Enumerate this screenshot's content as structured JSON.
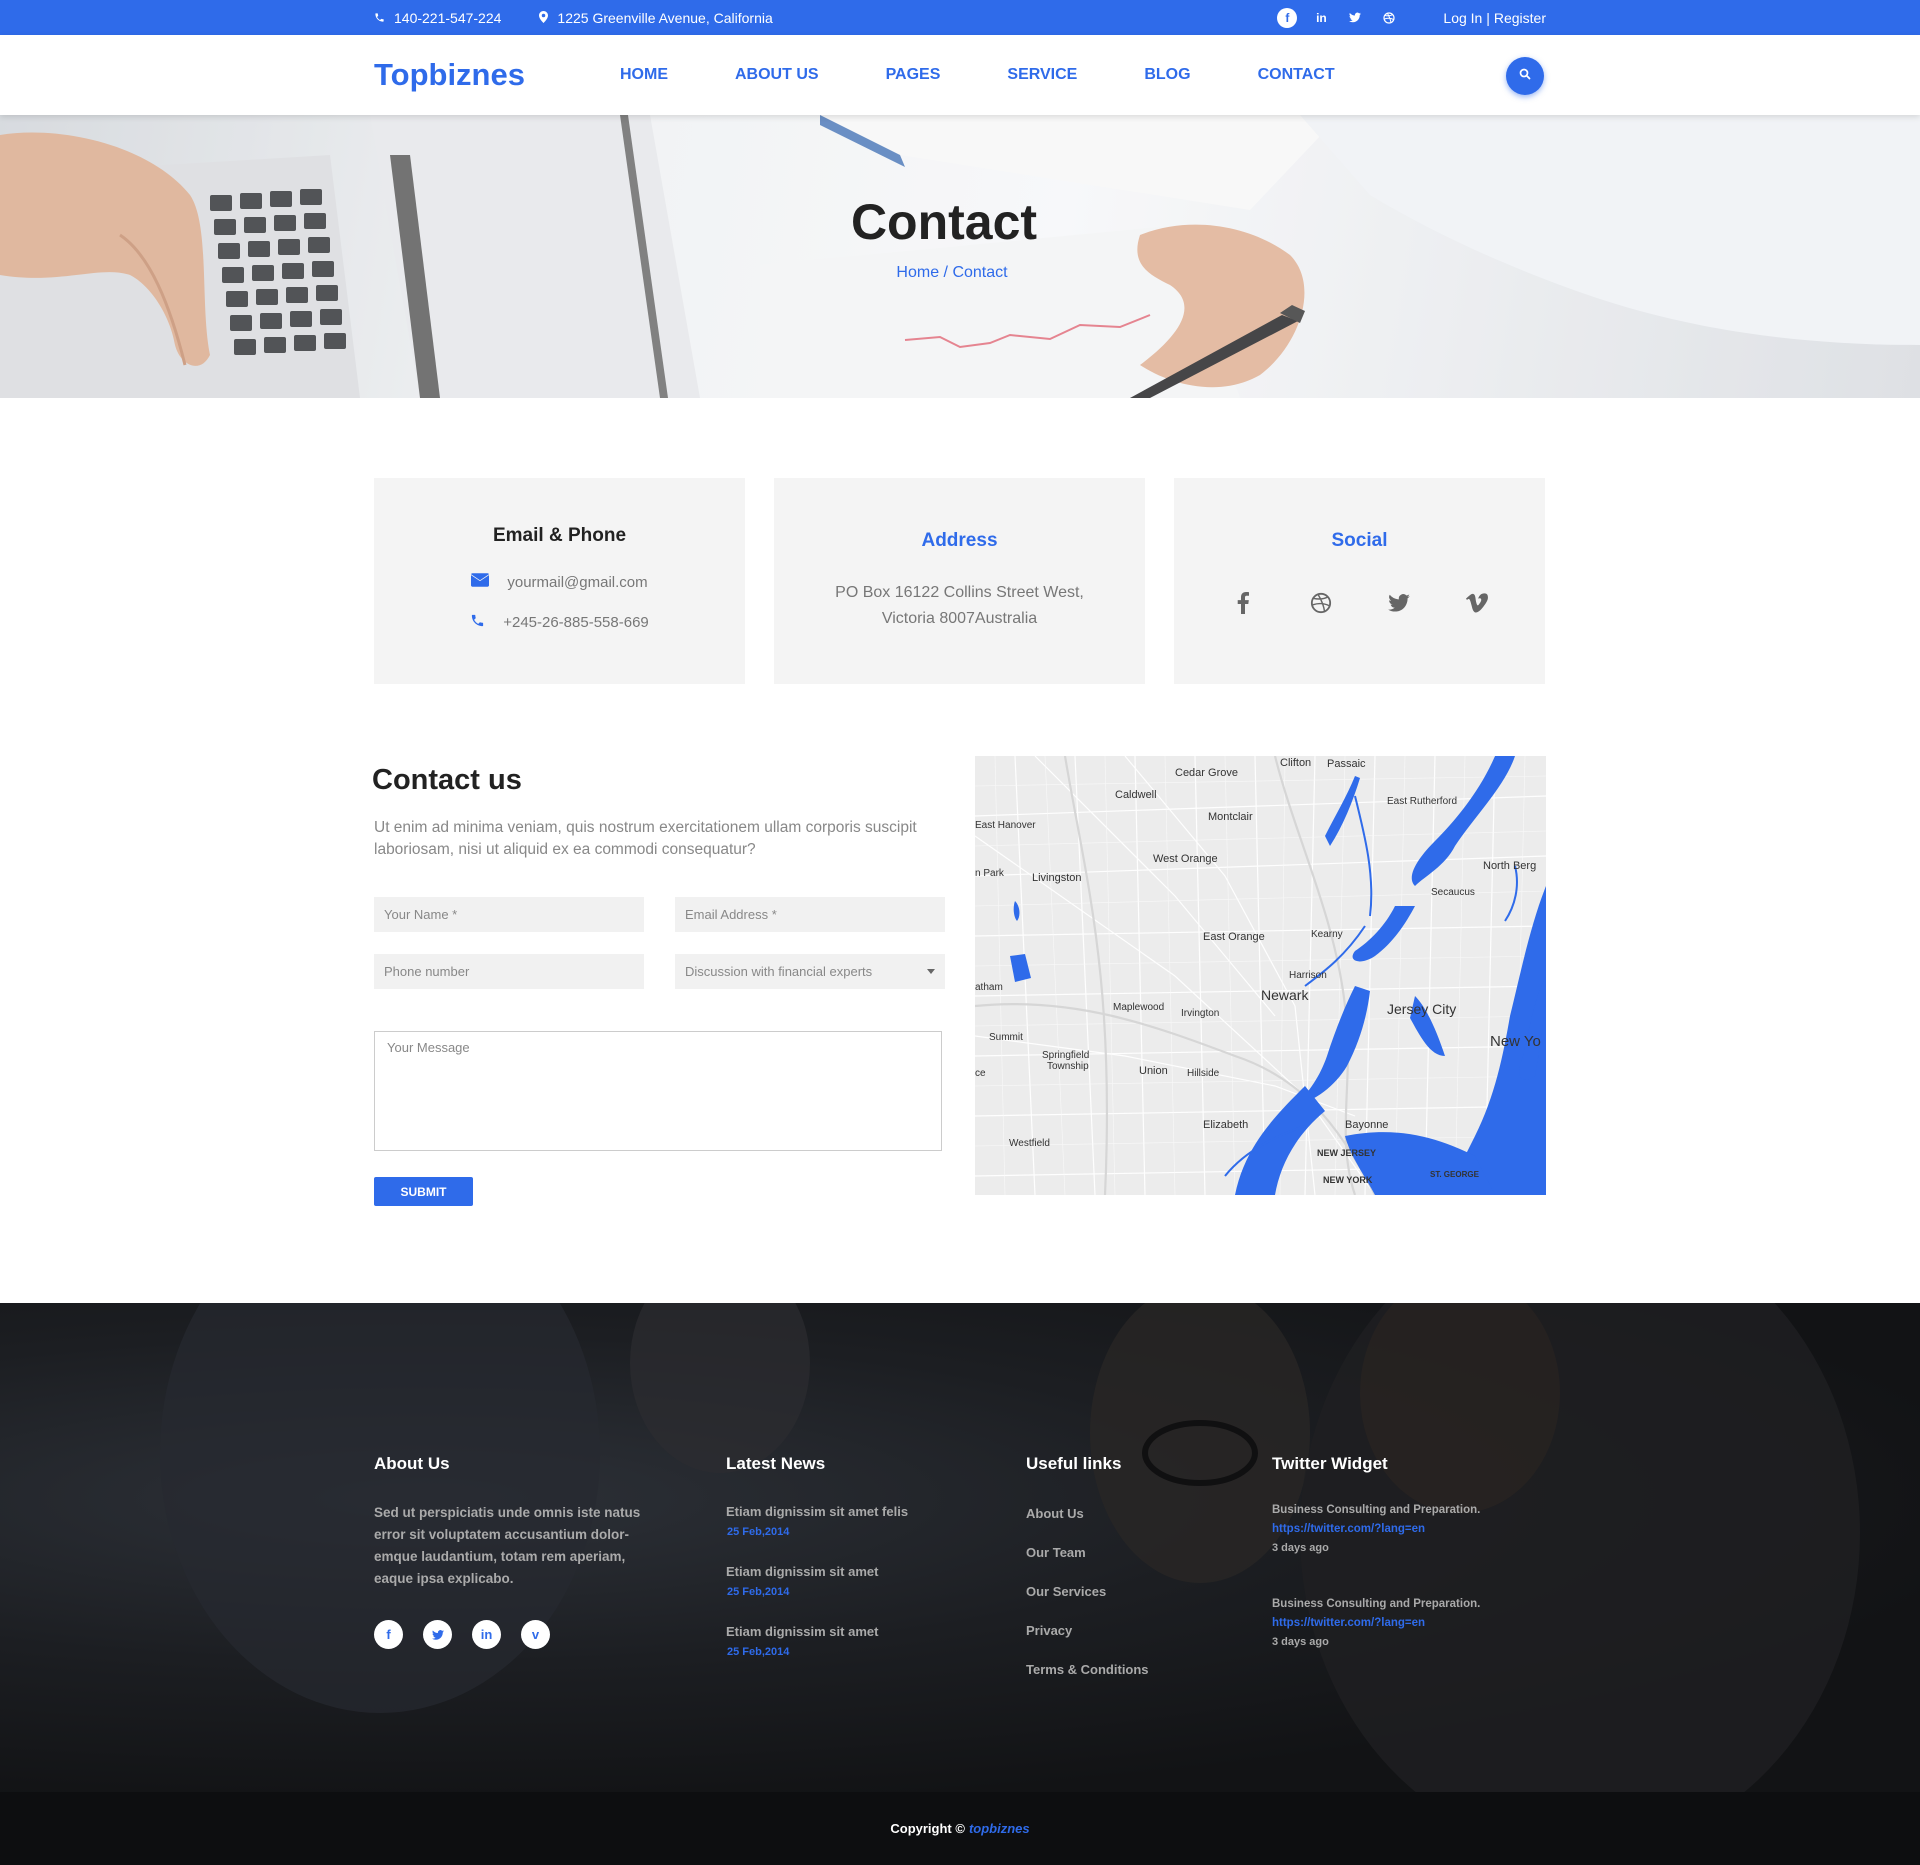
{
  "topbar": {
    "phone": "140-221-547-224",
    "address": "1225 Greenville Avenue, California",
    "social": [
      "f",
      "in",
      "t",
      "d"
    ],
    "login": "Log In |",
    "register": "Register"
  },
  "header": {
    "logo": "Topbiznes",
    "nav": [
      "HOME",
      "ABOUT US",
      "PAGES",
      "SERVICE",
      "BLOG",
      "CONTACT"
    ]
  },
  "hero": {
    "title": "Contact",
    "breadcrumb": "Home / Contact"
  },
  "cards": {
    "email_phone": {
      "title": "Email & Phone",
      "email": "yourmail@gmail.com",
      "phone": "+245-26-885-558-669"
    },
    "address": {
      "title": "Address",
      "line1": "PO Box 16122 Collins Street West,",
      "line2": "Victoria 8007Australia"
    },
    "social": {
      "title": "Social"
    }
  },
  "contact": {
    "title": "Contact us",
    "intro": "Ut enim ad minima veniam, quis nostrum exercitationem ullam corporis suscipit laboriosam, nisi ut aliquid ex ea commodi consequatur?",
    "name_placeholder": "Your Name *",
    "email_placeholder": "Email Address *",
    "phone_placeholder": "Phone number",
    "topic_selected": "Discussion with financial experts",
    "message_placeholder": "Your Message",
    "submit": "SUBMIT"
  },
  "map": {
    "labels": {
      "clifton": "Clifton",
      "passaic": "Passaic",
      "cedar_grove": "Cedar Grove",
      "caldwell": "Caldwell",
      "east_rutherford": "East Rutherford",
      "east_hanover": "East Hanover",
      "montclair": "Montclair",
      "north_bergen": "North Berg",
      "west_orange": "West Orange",
      "secaucus": "Secaucus",
      "park": "n Park",
      "livingston": "Livingston",
      "east_orange": "East Orange",
      "kearny": "Kearny",
      "harrison": "Harrison",
      "chatham": "atham",
      "newark": "Newark",
      "maplewood": "Maplewood",
      "irvington": "Irvington",
      "jersey_city": "Jersey City",
      "summit": "Summit",
      "new_york": "New Yo",
      "springfield": "Springfield",
      "township": "Township",
      "union": "Union",
      "hillside": "Hillside",
      "bayonne": "Bayonne",
      "elizabeth": "Elizabeth",
      "westfield": "Westfield",
      "new_jersey": "NEW JERSEY",
      "new_york_state": "NEW YORK",
      "st_george": "ST. GEORGE",
      "ce": "ce"
    },
    "water_color": "#2f6bea"
  },
  "footer": {
    "about": {
      "title": "About Us",
      "text": "Sed ut perspiciatis unde omnis iste natus error sit voluptatem accusantium dolor-emque laudantium, totam rem aperiam, eaque ipsa  explicabo.",
      "social": [
        "f",
        "t",
        "in",
        "v"
      ]
    },
    "news": {
      "title": "Latest News",
      "items": [
        {
          "title": "Etiam dignissim sit amet felis",
          "date": "25 Feb,2014"
        },
        {
          "title": "Etiam dignissim sit amet",
          "date": "25 Feb,2014"
        },
        {
          "title": "Etiam dignissim sit amet",
          "date": "25 Feb,2014"
        }
      ]
    },
    "links": {
      "title": "Useful links",
      "items": [
        "About Us",
        "Our Team",
        "Our Services",
        "Privacy",
        "Terms & Conditions"
      ]
    },
    "twitter": {
      "title": "Twitter Widget",
      "items": [
        {
          "text": "Business Consulting and Preparation.",
          "link": "https://twitter.com/?lang=en",
          "time": "3 days ago"
        },
        {
          "text": "Business Consulting and Preparation.",
          "link": "https://twitter.com/?lang=en",
          "time": "3 days ago"
        }
      ]
    }
  },
  "copyright": {
    "text": "Copyright ©",
    "brand": "topbiznes"
  },
  "colors": {
    "accent": "#2f6bea",
    "footer_bg": "#15161a"
  }
}
